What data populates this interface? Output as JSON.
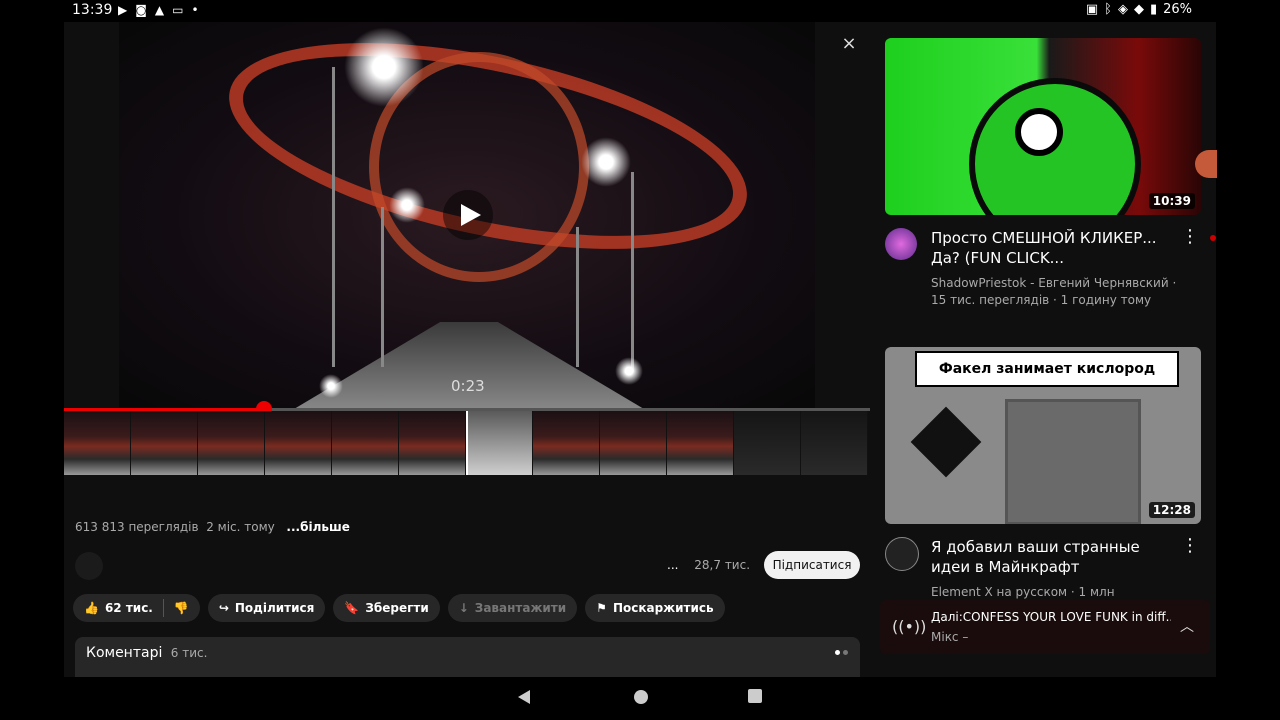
{
  "status_bar": {
    "time": "13:39",
    "left_icons": [
      "youtube-icon",
      "cast-icon",
      "warning-icon",
      "message-icon"
    ],
    "dot": "•",
    "battery": "26%"
  },
  "player": {
    "current_time": "0:23",
    "progress_fraction": 0.25,
    "close_glyph": "×"
  },
  "video": {
    "views": "613 813 переглядів",
    "age": "2 міс. тому",
    "more": "...більше",
    "dots": "...",
    "subscribers": "28,7 тис.",
    "subscribe": "Підписатися"
  },
  "actions": {
    "likes": "62 тис.",
    "share": "Поділитися",
    "save": "Зберегти",
    "download": "Завантажити",
    "report": "Поскаржитись"
  },
  "comments": {
    "title": "Коментарі",
    "count": "6 тис."
  },
  "recommendations": [
    {
      "title": "Просто СМЕШНОЙ КЛИКЕР... Да? (FUN CLICK...",
      "channel": "ShadowPriestok - Евгений Чернявский ·",
      "stats": "15 тис. переглядів · 1 годину тому",
      "duration": "10:39"
    },
    {
      "title": "Я добавил ваши странные идеи в Майнкрафт",
      "channel": "Element X на русском · 1 млн",
      "thumb_caption": "Факел занимает кислород",
      "duration": "12:28"
    }
  ],
  "up_next": {
    "title": "Далі:CONFESS YOUR LOVE FUNK in diff...",
    "subtitle": "Мікс –"
  },
  "colors": {
    "accent": "#ff0000",
    "background": "#0f0f0f",
    "chip": "#272727"
  }
}
